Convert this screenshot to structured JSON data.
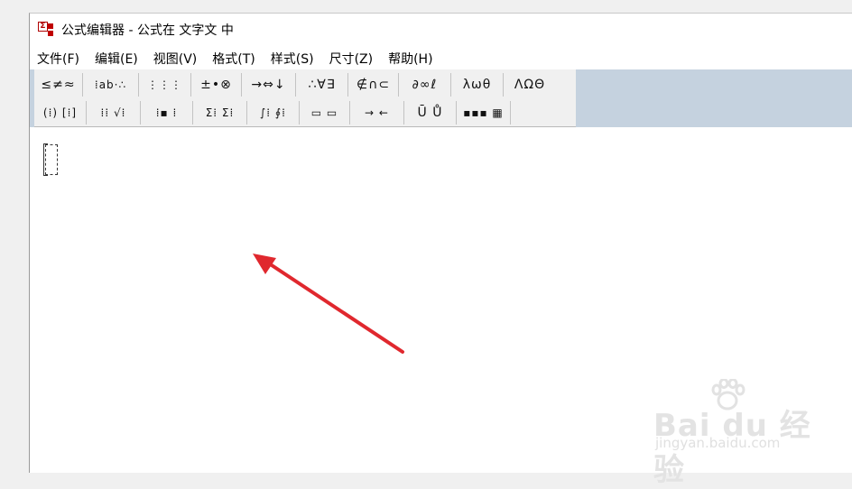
{
  "window": {
    "title": "公式编辑器 - 公式在 文字文 中",
    "app_icon_glyph": "Σ"
  },
  "menu": [
    {
      "label": "文件(F)"
    },
    {
      "label": "编辑(E)"
    },
    {
      "label": "视图(V)"
    },
    {
      "label": "格式(T)"
    },
    {
      "label": "样式(S)"
    },
    {
      "label": "尺寸(Z)"
    },
    {
      "label": "帮助(H)"
    }
  ],
  "toolbar": {
    "row1": [
      {
        "label": "≤≠≈",
        "icon": "relational-symbols-icon"
      },
      {
        "label": "⁞ab·∴",
        "icon": "spaces-ellipses-icon"
      },
      {
        "label": "⋮⋮⋮",
        "icon": "embellishments-icon"
      },
      {
        "label": "±•⊗",
        "icon": "operator-symbols-icon"
      },
      {
        "label": "→⇔↓",
        "icon": "arrow-symbols-icon"
      },
      {
        "label": "∴∀∃",
        "icon": "logical-symbols-icon"
      },
      {
        "label": "∉∩⊂",
        "icon": "set-theory-symbols-icon"
      },
      {
        "label": "∂∞ℓ",
        "icon": "miscellaneous-symbols-icon"
      },
      {
        "label": "λωθ",
        "icon": "greek-lowercase-icon"
      },
      {
        "label": "ΛΩΘ",
        "icon": "greek-uppercase-icon"
      }
    ],
    "row2": [
      {
        "label": "(⁞) [⁞]",
        "icon": "fence-templates-icon"
      },
      {
        "label": "⁞⁞ √⁞",
        "icon": "fraction-radical-templates-icon"
      },
      {
        "label": "⁞▪ ⁞",
        "icon": "subscript-superscript-templates-icon"
      },
      {
        "label": "Σ⁞ Σ⁞",
        "icon": "summation-templates-icon"
      },
      {
        "label": "∫⁞ ∮⁞",
        "icon": "integral-templates-icon"
      },
      {
        "label": "▭ ▭",
        "icon": "underbar-overbar-templates-icon"
      },
      {
        "label": "→ ←",
        "icon": "labeled-arrow-templates-icon"
      },
      {
        "label": "Ū Ů",
        "icon": "products-set-theory-templates-icon"
      },
      {
        "label": "▪▪▪ ▦",
        "icon": "matrix-templates-icon"
      }
    ]
  },
  "colors": {
    "toolbar_bg": "#f0f0f0",
    "toolbar_strip": "#c5d2df",
    "annotation_arrow": "#e0282e",
    "app_icon_red": "#c00000"
  },
  "watermark": {
    "brand": "Bai du 经验",
    "url": "jingyan.baidu.com"
  }
}
